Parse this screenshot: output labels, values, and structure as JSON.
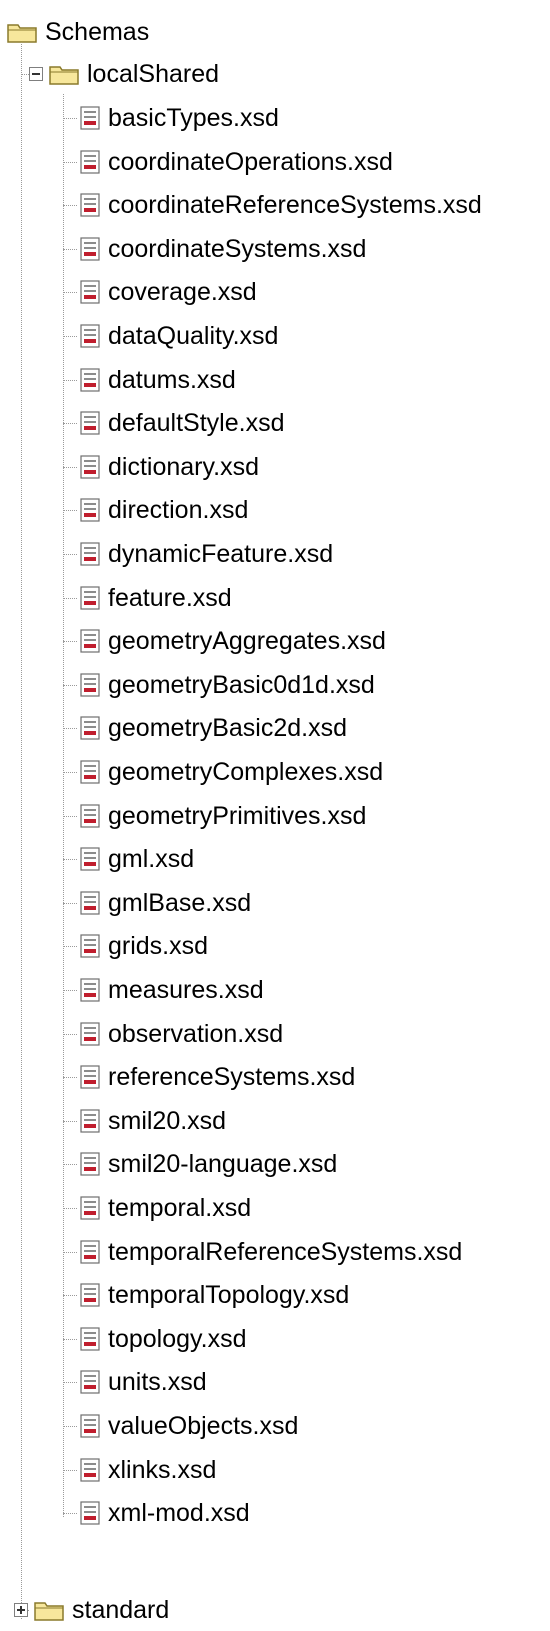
{
  "tree": {
    "root": {
      "label": "Schemas"
    },
    "localShared": {
      "label": "localShared",
      "expanded": true,
      "files": [
        "basicTypes.xsd",
        "coordinateOperations.xsd",
        "coordinateReferenceSystems.xsd",
        "coordinateSystems.xsd",
        "coverage.xsd",
        "dataQuality.xsd",
        "datums.xsd",
        "defaultStyle.xsd",
        "dictionary.xsd",
        "direction.xsd",
        "dynamicFeature.xsd",
        "feature.xsd",
        "geometryAggregates.xsd",
        "geometryBasic0d1d.xsd",
        "geometryBasic2d.xsd",
        "geometryComplexes.xsd",
        "geometryPrimitives.xsd",
        "gml.xsd",
        "gmlBase.xsd",
        "grids.xsd",
        "measures.xsd",
        "observation.xsd",
        "referenceSystems.xsd",
        "smil20.xsd",
        "smil20-language.xsd",
        "temporal.xsd",
        "temporalReferenceSystems.xsd",
        "temporalTopology.xsd",
        "topology.xsd",
        "units.xsd",
        "valueObjects.xsd",
        "xlinks.xsd",
        "xml-mod.xsd"
      ]
    },
    "standard": {
      "label": "standard",
      "expanded": false
    }
  },
  "icons": {
    "folder": "folder-icon",
    "file": "xsd-file-icon",
    "collapse": "collapse-icon",
    "expand": "expand-icon"
  },
  "colors": {
    "folder_fill": "#f7e79c",
    "folder_stroke": "#8a7a2c",
    "tree_lines": "#9a9a9a",
    "file_accent": "#c01e2e"
  }
}
